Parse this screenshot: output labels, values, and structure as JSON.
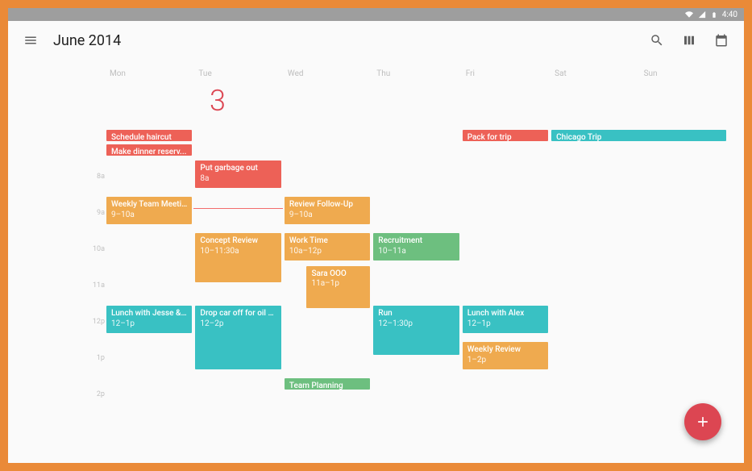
{
  "status": {
    "clock": "4:40"
  },
  "appbar": {
    "title": "June 2014"
  },
  "big_date": "3",
  "day_labels": [
    "Mon",
    "Tue",
    "Wed",
    "Thu",
    "Fri",
    "Sat",
    "Sun"
  ],
  "time_labels": [
    "8a",
    "9a",
    "10a",
    "11a",
    "12p",
    "1p",
    "2p"
  ],
  "colors": {
    "red": "#ed6157",
    "orange": "#efaa4f",
    "teal": "#39c1c3",
    "green": "#6dbf7f"
  },
  "events": [
    {
      "title": "Schedule haircut",
      "time": "",
      "col": 0,
      "row": 0.15,
      "h": 0.35,
      "color": "red"
    },
    {
      "title": "Make dinner reserv...",
      "time": "",
      "col": 0,
      "row": 0.55,
      "h": 0.35,
      "color": "red"
    },
    {
      "title": "Pack for trip",
      "time": "",
      "col": 4,
      "row": 0.15,
      "h": 0.35,
      "color": "red"
    },
    {
      "title": "Chicago Trip",
      "time": "",
      "col": 5,
      "span": 2,
      "row": 0.15,
      "h": 0.35,
      "color": "teal"
    },
    {
      "title": "Put garbage out",
      "time": "8a",
      "col": 1,
      "row": 1.0,
      "h": 0.8,
      "color": "red"
    },
    {
      "title": "Weekly Team Meeting",
      "time": "9–10a",
      "col": 0,
      "row": 2.0,
      "h": 0.8,
      "color": "orange"
    },
    {
      "title": "Review Follow-Up",
      "time": "9–10a",
      "col": 2,
      "row": 2.0,
      "h": 0.8,
      "color": "orange"
    },
    {
      "title": "Concept Review",
      "time": "10–11:30a",
      "col": 1,
      "row": 3.0,
      "h": 1.4,
      "color": "orange"
    },
    {
      "title": "Work Time",
      "time": "10a–12p",
      "col": 2,
      "row": 3.0,
      "h": 0.8,
      "color": "orange"
    },
    {
      "title": "Recruitment",
      "time": "10–11a",
      "col": 3,
      "row": 3.0,
      "h": 0.8,
      "color": "green"
    },
    {
      "title": "Sara OOO",
      "time": "11a–1p",
      "col": 2,
      "row": 3.9,
      "h": 1.2,
      "color": "orange",
      "offset": 0.25,
      "w": 0.75
    },
    {
      "title": "Lunch with Jesse & A...",
      "time": "12–1p",
      "col": 0,
      "row": 5.0,
      "h": 0.8,
      "color": "teal"
    },
    {
      "title": "Drop car off for oil change",
      "time": "12–2p",
      "col": 1,
      "row": 5.0,
      "h": 1.8,
      "color": "teal"
    },
    {
      "title": "Run",
      "time": "12–1:30p",
      "col": 3,
      "row": 5.0,
      "h": 1.4,
      "color": "teal"
    },
    {
      "title": "Lunch with Alex",
      "time": "12–1p",
      "col": 4,
      "row": 5.0,
      "h": 0.8,
      "color": "teal"
    },
    {
      "title": "Weekly Review",
      "time": "1–2p",
      "col": 4,
      "row": 6.0,
      "h": 0.8,
      "color": "orange"
    },
    {
      "title": "Team Planning",
      "time": "",
      "col": 2,
      "row": 7.0,
      "h": 0.35,
      "color": "green"
    }
  ],
  "now": {
    "col": 1,
    "row": 2.3
  }
}
